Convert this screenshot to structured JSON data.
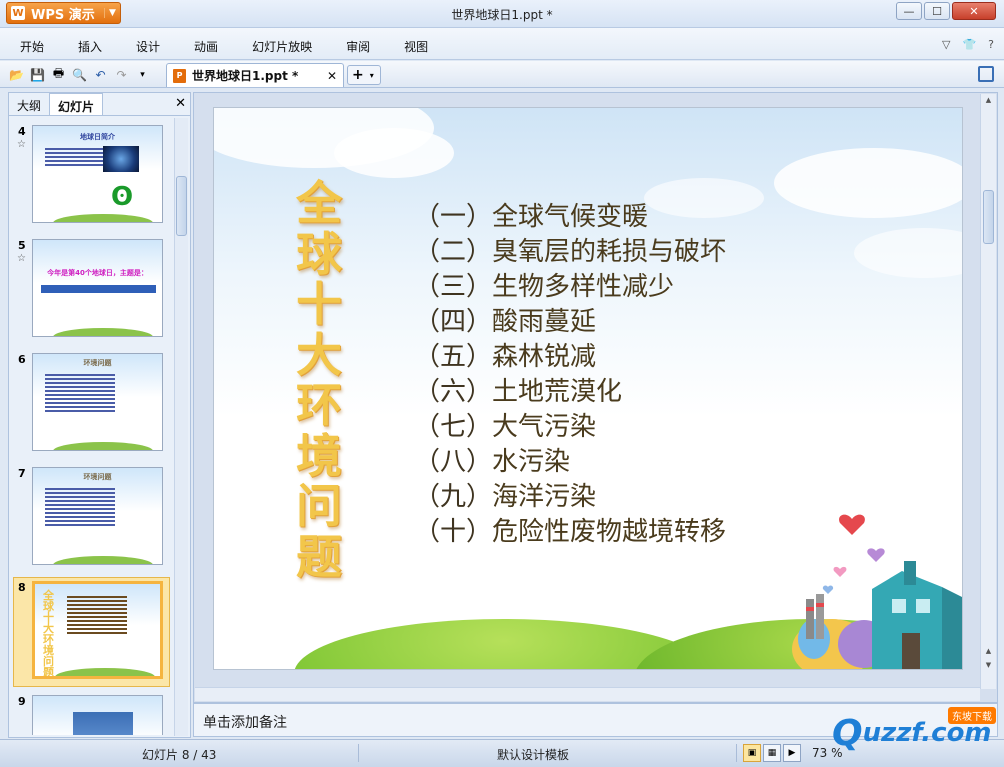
{
  "app": {
    "name": "WPS 演示",
    "window_title": "世界地球日1.ppt *"
  },
  "menu": [
    "开始",
    "插入",
    "设计",
    "动画",
    "幻灯片放映",
    "审阅",
    "视图"
  ],
  "toolbar": {
    "doc_tab": "世界地球日1.ppt *",
    "new_tab": "+"
  },
  "sidebar": {
    "tabs": [
      "大纲",
      "幻灯片"
    ],
    "active_tab": "幻灯片",
    "thumbnails": [
      {
        "num": "4",
        "starred": true,
        "title": "地球日简介"
      },
      {
        "num": "5",
        "starred": true,
        "title": "今年是第40个地球日，主题是："
      },
      {
        "num": "6",
        "starred": false,
        "title": "环境问题"
      },
      {
        "num": "7",
        "starred": false,
        "title": "环境问题"
      },
      {
        "num": "8",
        "starred": false,
        "title": "全球十大环境问题",
        "selected": true
      },
      {
        "num": "9",
        "starred": false,
        "title": ""
      }
    ]
  },
  "slide": {
    "title_chars": [
      "全",
      "球",
      "十",
      "大",
      "环",
      "境",
      "问",
      "题"
    ],
    "items": [
      {
        "index": "（一）",
        "text": "全球气候变暖"
      },
      {
        "index": "（二）",
        "text": "臭氧层的耗损与破坏"
      },
      {
        "index": "（三）",
        "text": "生物多样性减少"
      },
      {
        "index": "（四）",
        "text": "酸雨蔓延"
      },
      {
        "index": "（五）",
        "text": "森林锐减"
      },
      {
        "index": "（六）",
        "text": "土地荒漠化"
      },
      {
        "index": "（七）",
        "text": "大气污染"
      },
      {
        "index": "（八）",
        "text": "水污染"
      },
      {
        "index": "（九）",
        "text": "海洋污染"
      },
      {
        "index": "（十）",
        "text": "危险性废物越境转移"
      }
    ]
  },
  "notes": {
    "placeholder": "单击添加备注"
  },
  "status": {
    "slide_counter": "幻灯片 8 / 43",
    "template": "默认设计模板",
    "zoom": "73 %"
  },
  "watermark": {
    "brand": "uzzf.com",
    "tag": "东坡下载"
  }
}
